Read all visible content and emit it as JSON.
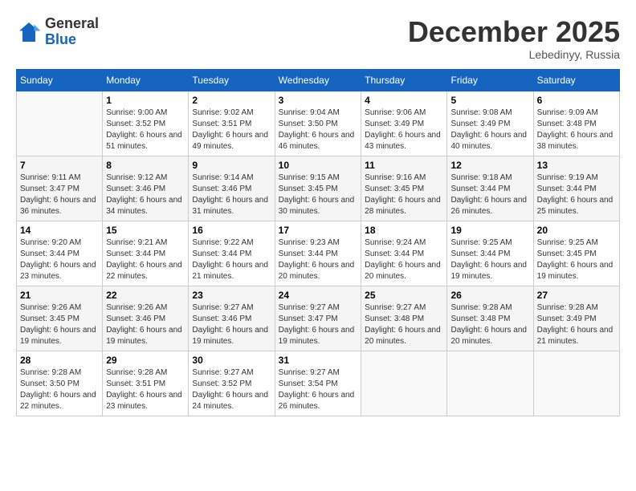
{
  "header": {
    "logo_general": "General",
    "logo_blue": "Blue",
    "month_title": "December 2025",
    "location": "Lebedinyy, Russia"
  },
  "weekdays": [
    "Sunday",
    "Monday",
    "Tuesday",
    "Wednesday",
    "Thursday",
    "Friday",
    "Saturday"
  ],
  "weeks": [
    [
      {
        "day": "",
        "info": ""
      },
      {
        "day": "1",
        "info": "Sunrise: 9:00 AM\nSunset: 3:52 PM\nDaylight: 6 hours and 51 minutes."
      },
      {
        "day": "2",
        "info": "Sunrise: 9:02 AM\nSunset: 3:51 PM\nDaylight: 6 hours and 49 minutes."
      },
      {
        "day": "3",
        "info": "Sunrise: 9:04 AM\nSunset: 3:50 PM\nDaylight: 6 hours and 46 minutes."
      },
      {
        "day": "4",
        "info": "Sunrise: 9:06 AM\nSunset: 3:49 PM\nDaylight: 6 hours and 43 minutes."
      },
      {
        "day": "5",
        "info": "Sunrise: 9:08 AM\nSunset: 3:49 PM\nDaylight: 6 hours and 40 minutes."
      },
      {
        "day": "6",
        "info": "Sunrise: 9:09 AM\nSunset: 3:48 PM\nDaylight: 6 hours and 38 minutes."
      }
    ],
    [
      {
        "day": "7",
        "info": "Sunrise: 9:11 AM\nSunset: 3:47 PM\nDaylight: 6 hours and 36 minutes."
      },
      {
        "day": "8",
        "info": "Sunrise: 9:12 AM\nSunset: 3:46 PM\nDaylight: 6 hours and 34 minutes."
      },
      {
        "day": "9",
        "info": "Sunrise: 9:14 AM\nSunset: 3:46 PM\nDaylight: 6 hours and 31 minutes."
      },
      {
        "day": "10",
        "info": "Sunrise: 9:15 AM\nSunset: 3:45 PM\nDaylight: 6 hours and 30 minutes."
      },
      {
        "day": "11",
        "info": "Sunrise: 9:16 AM\nSunset: 3:45 PM\nDaylight: 6 hours and 28 minutes."
      },
      {
        "day": "12",
        "info": "Sunrise: 9:18 AM\nSunset: 3:44 PM\nDaylight: 6 hours and 26 minutes."
      },
      {
        "day": "13",
        "info": "Sunrise: 9:19 AM\nSunset: 3:44 PM\nDaylight: 6 hours and 25 minutes."
      }
    ],
    [
      {
        "day": "14",
        "info": "Sunrise: 9:20 AM\nSunset: 3:44 PM\nDaylight: 6 hours and 23 minutes."
      },
      {
        "day": "15",
        "info": "Sunrise: 9:21 AM\nSunset: 3:44 PM\nDaylight: 6 hours and 22 minutes."
      },
      {
        "day": "16",
        "info": "Sunrise: 9:22 AM\nSunset: 3:44 PM\nDaylight: 6 hours and 21 minutes."
      },
      {
        "day": "17",
        "info": "Sunrise: 9:23 AM\nSunset: 3:44 PM\nDaylight: 6 hours and 20 minutes."
      },
      {
        "day": "18",
        "info": "Sunrise: 9:24 AM\nSunset: 3:44 PM\nDaylight: 6 hours and 20 minutes."
      },
      {
        "day": "19",
        "info": "Sunrise: 9:25 AM\nSunset: 3:44 PM\nDaylight: 6 hours and 19 minutes."
      },
      {
        "day": "20",
        "info": "Sunrise: 9:25 AM\nSunset: 3:45 PM\nDaylight: 6 hours and 19 minutes."
      }
    ],
    [
      {
        "day": "21",
        "info": "Sunrise: 9:26 AM\nSunset: 3:45 PM\nDaylight: 6 hours and 19 minutes."
      },
      {
        "day": "22",
        "info": "Sunrise: 9:26 AM\nSunset: 3:46 PM\nDaylight: 6 hours and 19 minutes."
      },
      {
        "day": "23",
        "info": "Sunrise: 9:27 AM\nSunset: 3:46 PM\nDaylight: 6 hours and 19 minutes."
      },
      {
        "day": "24",
        "info": "Sunrise: 9:27 AM\nSunset: 3:47 PM\nDaylight: 6 hours and 19 minutes."
      },
      {
        "day": "25",
        "info": "Sunrise: 9:27 AM\nSunset: 3:48 PM\nDaylight: 6 hours and 20 minutes."
      },
      {
        "day": "26",
        "info": "Sunrise: 9:28 AM\nSunset: 3:48 PM\nDaylight: 6 hours and 20 minutes."
      },
      {
        "day": "27",
        "info": "Sunrise: 9:28 AM\nSunset: 3:49 PM\nDaylight: 6 hours and 21 minutes."
      }
    ],
    [
      {
        "day": "28",
        "info": "Sunrise: 9:28 AM\nSunset: 3:50 PM\nDaylight: 6 hours and 22 minutes."
      },
      {
        "day": "29",
        "info": "Sunrise: 9:28 AM\nSunset: 3:51 PM\nDaylight: 6 hours and 23 minutes."
      },
      {
        "day": "30",
        "info": "Sunrise: 9:27 AM\nSunset: 3:52 PM\nDaylight: 6 hours and 24 minutes."
      },
      {
        "day": "31",
        "info": "Sunrise: 9:27 AM\nSunset: 3:54 PM\nDaylight: 6 hours and 26 minutes."
      },
      {
        "day": "",
        "info": ""
      },
      {
        "day": "",
        "info": ""
      },
      {
        "day": "",
        "info": ""
      }
    ]
  ]
}
